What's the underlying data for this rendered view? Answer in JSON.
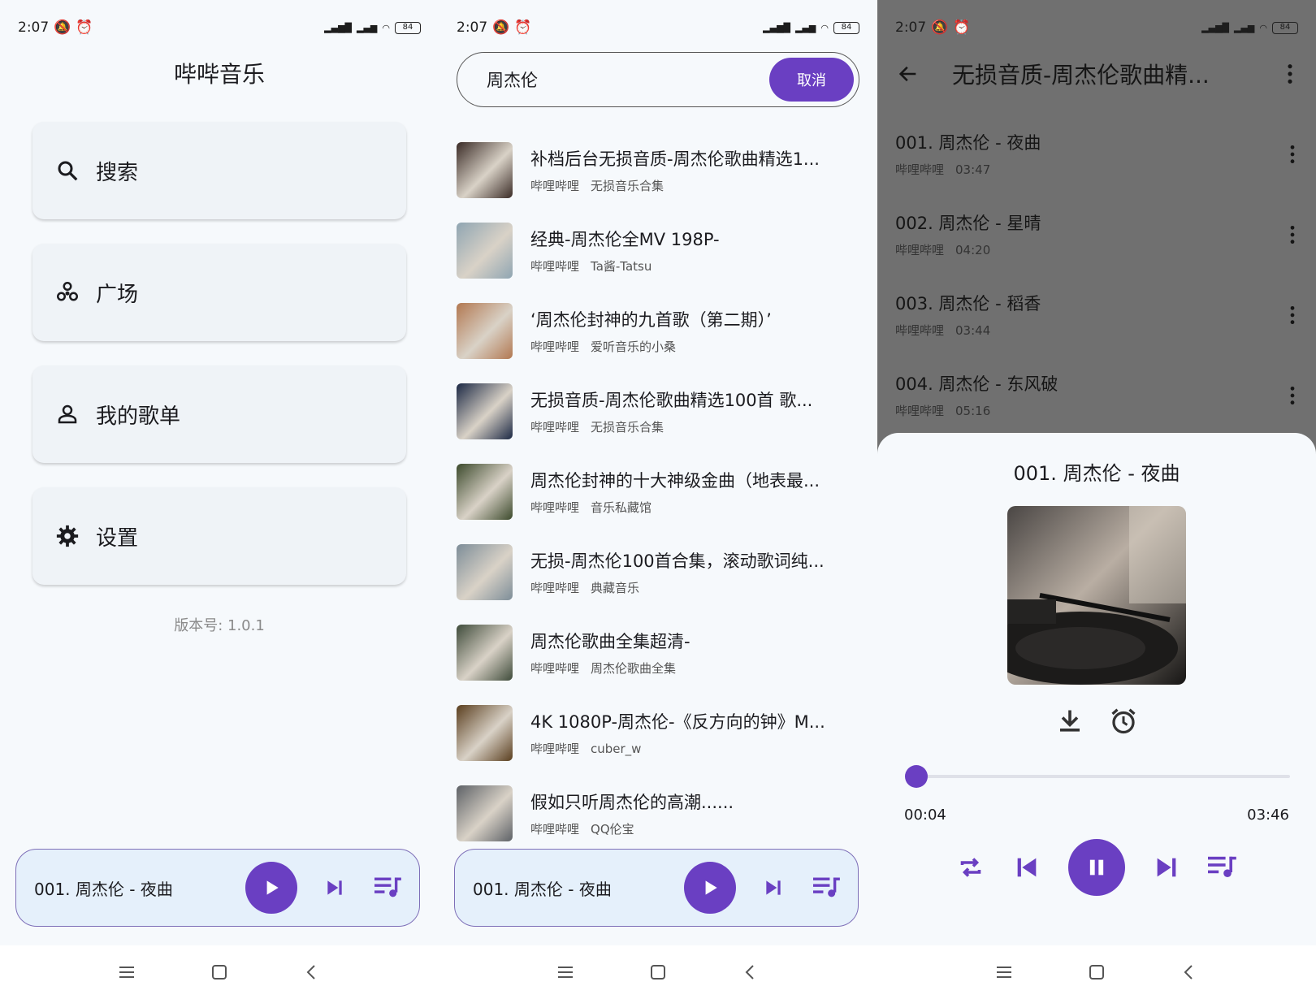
{
  "status": {
    "time": "2:07",
    "battery": "84"
  },
  "home": {
    "title": "哔哔音乐",
    "menu": [
      {
        "label": "搜索",
        "icon": "search-icon"
      },
      {
        "label": "广场",
        "icon": "plaza-icon"
      },
      {
        "label": "我的歌单",
        "icon": "person-icon"
      },
      {
        "label": "设置",
        "icon": "gear-icon"
      }
    ],
    "version": "版本号: 1.0.1"
  },
  "mini_player": {
    "title": "001. 周杰伦 - 夜曲"
  },
  "search": {
    "query": "周杰伦",
    "cancel_label": "取消",
    "results": [
      {
        "title": "补档后台无损音质-周杰伦歌曲精选1...",
        "source": "哔哩哔哩",
        "author": "无损音乐合集",
        "color": "#3a2b26"
      },
      {
        "title": "经典-周杰伦全MV 198P-",
        "source": "哔哩哔哩",
        "author": "Ta酱-Tatsu",
        "color": "#8fa5b2"
      },
      {
        "title": "‘周杰伦封神的九首歌（第二期）’",
        "source": "哔哩哔哩",
        "author": "爱听音乐的小桑",
        "color": "#b27851"
      },
      {
        "title": "无损音质-周杰伦歌曲精选100首 歌...",
        "source": "哔哩哔哩",
        "author": "无损音乐合集",
        "color": "#1b2844"
      },
      {
        "title": "周杰伦封神的十大神级金曲（地表最...",
        "source": "哔哩哔哩",
        "author": "音乐私藏馆",
        "color": "#3c4a2c"
      },
      {
        "title": "无损-周杰伦100首合集，滚动歌词纯...",
        "source": "哔哩哔哩",
        "author": "典藏音乐",
        "color": "#7d8d98"
      },
      {
        "title": "周杰伦歌曲全集超清-",
        "source": "哔哩哔哩",
        "author": "周杰伦歌曲全集",
        "color": "#3e4b3a"
      },
      {
        "title": "4K 1080P-周杰伦-《反方向的钟》M...",
        "source": "哔哩哔哩",
        "author": "cuber_w",
        "color": "#5a3e1e"
      },
      {
        "title": "假如只听周杰伦的高潮......",
        "source": "哔哩哔哩",
        "author": "QQ伦宝",
        "color": "#5d6166"
      }
    ]
  },
  "album": {
    "title": "无损音质-周杰伦歌曲精...",
    "tracks": [
      {
        "title": "001. 周杰伦 - 夜曲",
        "source": "哔哩哔哩",
        "duration": "03:47"
      },
      {
        "title": "002. 周杰伦 - 星晴",
        "source": "哔哩哔哩",
        "duration": "04:20"
      },
      {
        "title": "003. 周杰伦 - 稻香",
        "source": "哔哩哔哩",
        "duration": "03:44"
      },
      {
        "title": "004. 周杰伦 - 东风破",
        "source": "哔哩哔哩",
        "duration": "05:16"
      }
    ]
  },
  "now_playing": {
    "title": "001. 周杰伦 - 夜曲",
    "elapsed": "00:04",
    "total": "03:46",
    "progress": 0.018
  },
  "colors": {
    "accent": "#6a3fc2",
    "mini_bg": "#e5f0fb"
  }
}
